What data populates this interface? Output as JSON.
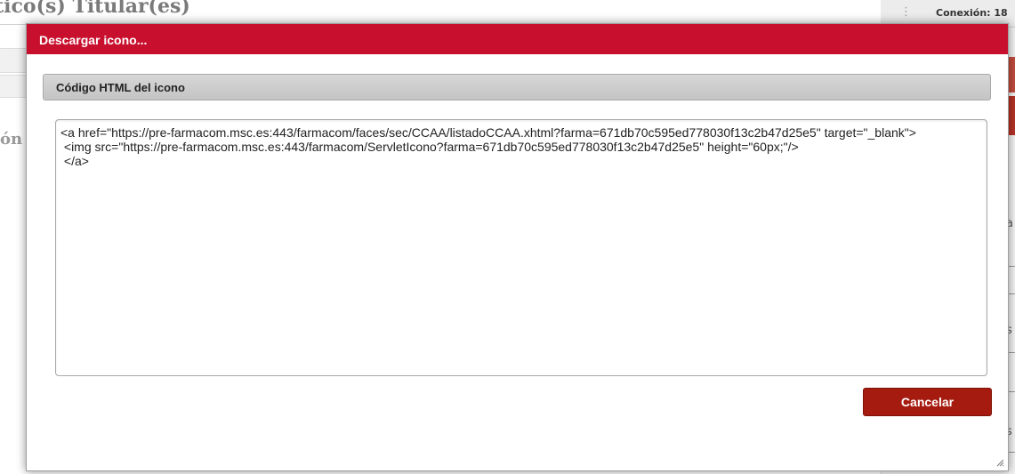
{
  "background": {
    "page_title": "tico(s) Titular(es)",
    "connection_label": "Conexión: 18",
    "menu_dots": "⋮",
    "left_fragment": "ón",
    "right_fragment_1": "n",
    "right_fragment_2": "g",
    "right_fragment_3": "s",
    "right_fragment_4": "s",
    "right_fragment_5": "a"
  },
  "dialog": {
    "title": "Descargar icono...",
    "section_title": "Código HTML del icono",
    "code": "<a href=\"https://pre-farmacom.msc.es:443/farmacom/faces/sec/CCAA/listadoCCAA.xhtml?farma=671db70c595ed778030f13c2b47d25e5\" target=\"_blank\">\n <img src=\"https://pre-farmacom.msc.es:443/farmacom/ServletIcono?farma=671db70c595ed778030f13c2b47d25e5\" height=\"60px;\"/>\n </a>",
    "cancel_label": "Cancelar"
  },
  "colors": {
    "titlebar": "#c8102e",
    "cancel_button": "#a61b10",
    "section_header": "#cccccc"
  },
  "icons": {
    "resize_grip": "resize-grip-icon"
  }
}
